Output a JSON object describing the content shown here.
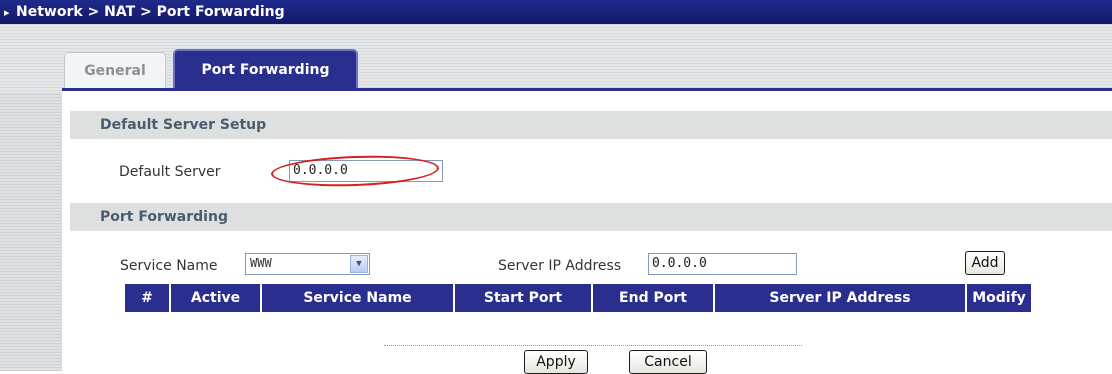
{
  "titlebar": {
    "breadcrumb": "Network > NAT > Port Forwarding"
  },
  "tabs": [
    {
      "label": "General",
      "active": false
    },
    {
      "label": "Port Forwarding",
      "active": true
    }
  ],
  "default_server_setup": {
    "heading": "Default Server Setup",
    "default_server_label": "Default Server",
    "default_server_value": "0.0.0.0"
  },
  "port_forwarding": {
    "heading": "Port Forwarding",
    "service_name_label": "Service Name",
    "service_name_selected": "WWW",
    "server_ip_label": "Server IP Address",
    "server_ip_value": "0.0.0.0",
    "add_label": "Add",
    "columns": [
      "#",
      "Active",
      "Service Name",
      "Start Port",
      "End Port",
      "Server IP Address",
      "Modify"
    ],
    "rows": []
  },
  "actions": {
    "apply_label": "Apply",
    "cancel_label": "Cancel"
  },
  "colors": {
    "accent": "#2a2f8f",
    "annotation": "#d42020",
    "section_bg": "#dde0df"
  },
  "icons": {
    "breadcrumb": "chevron-right-icon",
    "dropdown": "chevron-down-icon"
  }
}
